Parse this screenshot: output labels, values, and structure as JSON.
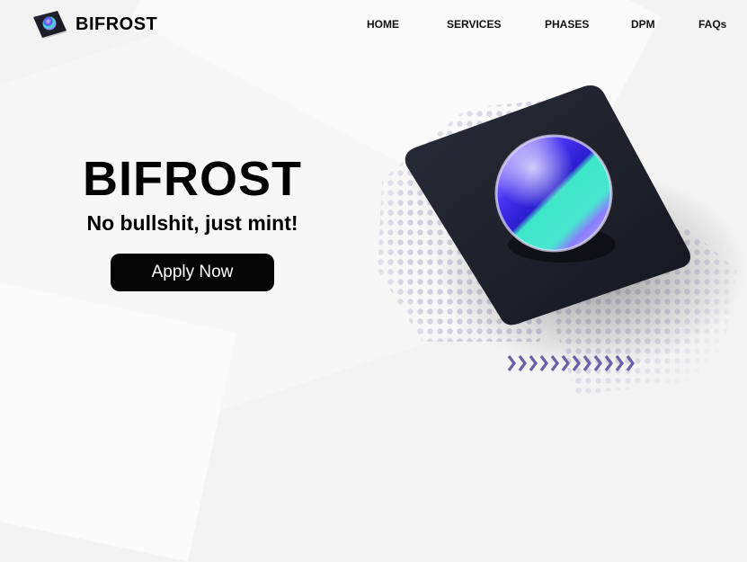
{
  "brand": {
    "name": "BIFROST",
    "icon": "orb-tile-logo-icon"
  },
  "nav": {
    "items": [
      {
        "label": "HOME"
      },
      {
        "label": "SERVICES"
      },
      {
        "label": "PHASES"
      },
      {
        "label": "DPM"
      },
      {
        "label": "FAQs"
      }
    ]
  },
  "hero": {
    "title": "BIFROST",
    "subtitle": "No bullshit, just mint!",
    "cta_label": "Apply Now"
  },
  "colors": {
    "background": "#f4f3f3",
    "button": "#050505",
    "tile": "#20212c",
    "orb_blue": "#3b2cf0",
    "orb_teal": "#3de6c8",
    "dots": "#c9c6d6",
    "chevrons": "#6a60a8"
  }
}
